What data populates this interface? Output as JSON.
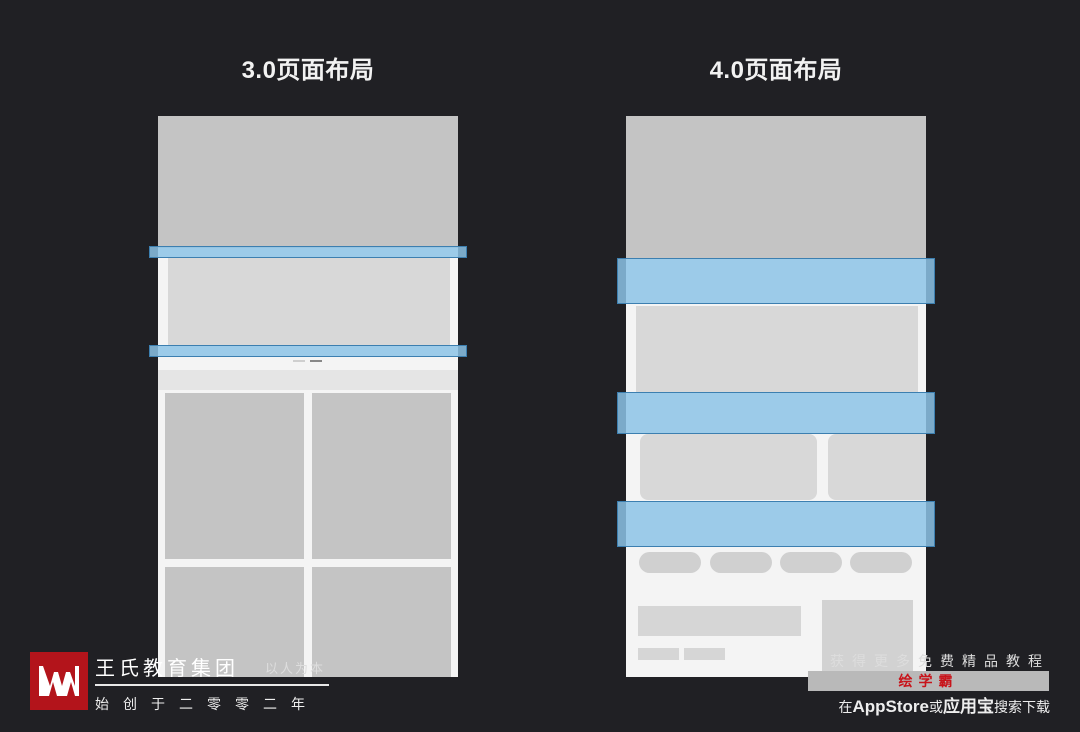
{
  "left_layout": {
    "title": "3.0页面布局"
  },
  "right_layout": {
    "title": "4.0页面布局"
  },
  "footer": {
    "brand_name": "王氏教育集团",
    "brand_slogan": "以人为本",
    "brand_motto": "始创于二零零二年",
    "promo_line1": "获得更多免费精品教程",
    "promo_app": "绘学霸",
    "promo_prefix": "在",
    "promo_store": "AppStore",
    "promo_or": "或",
    "promo_market": "应用宝",
    "promo_suffix": "搜索下载"
  },
  "colors": {
    "background": "#202024",
    "highlight": "#8cc3e6",
    "brand_red": "#b3141b"
  },
  "icons": {
    "logo": "wangshi-logo-icon"
  }
}
